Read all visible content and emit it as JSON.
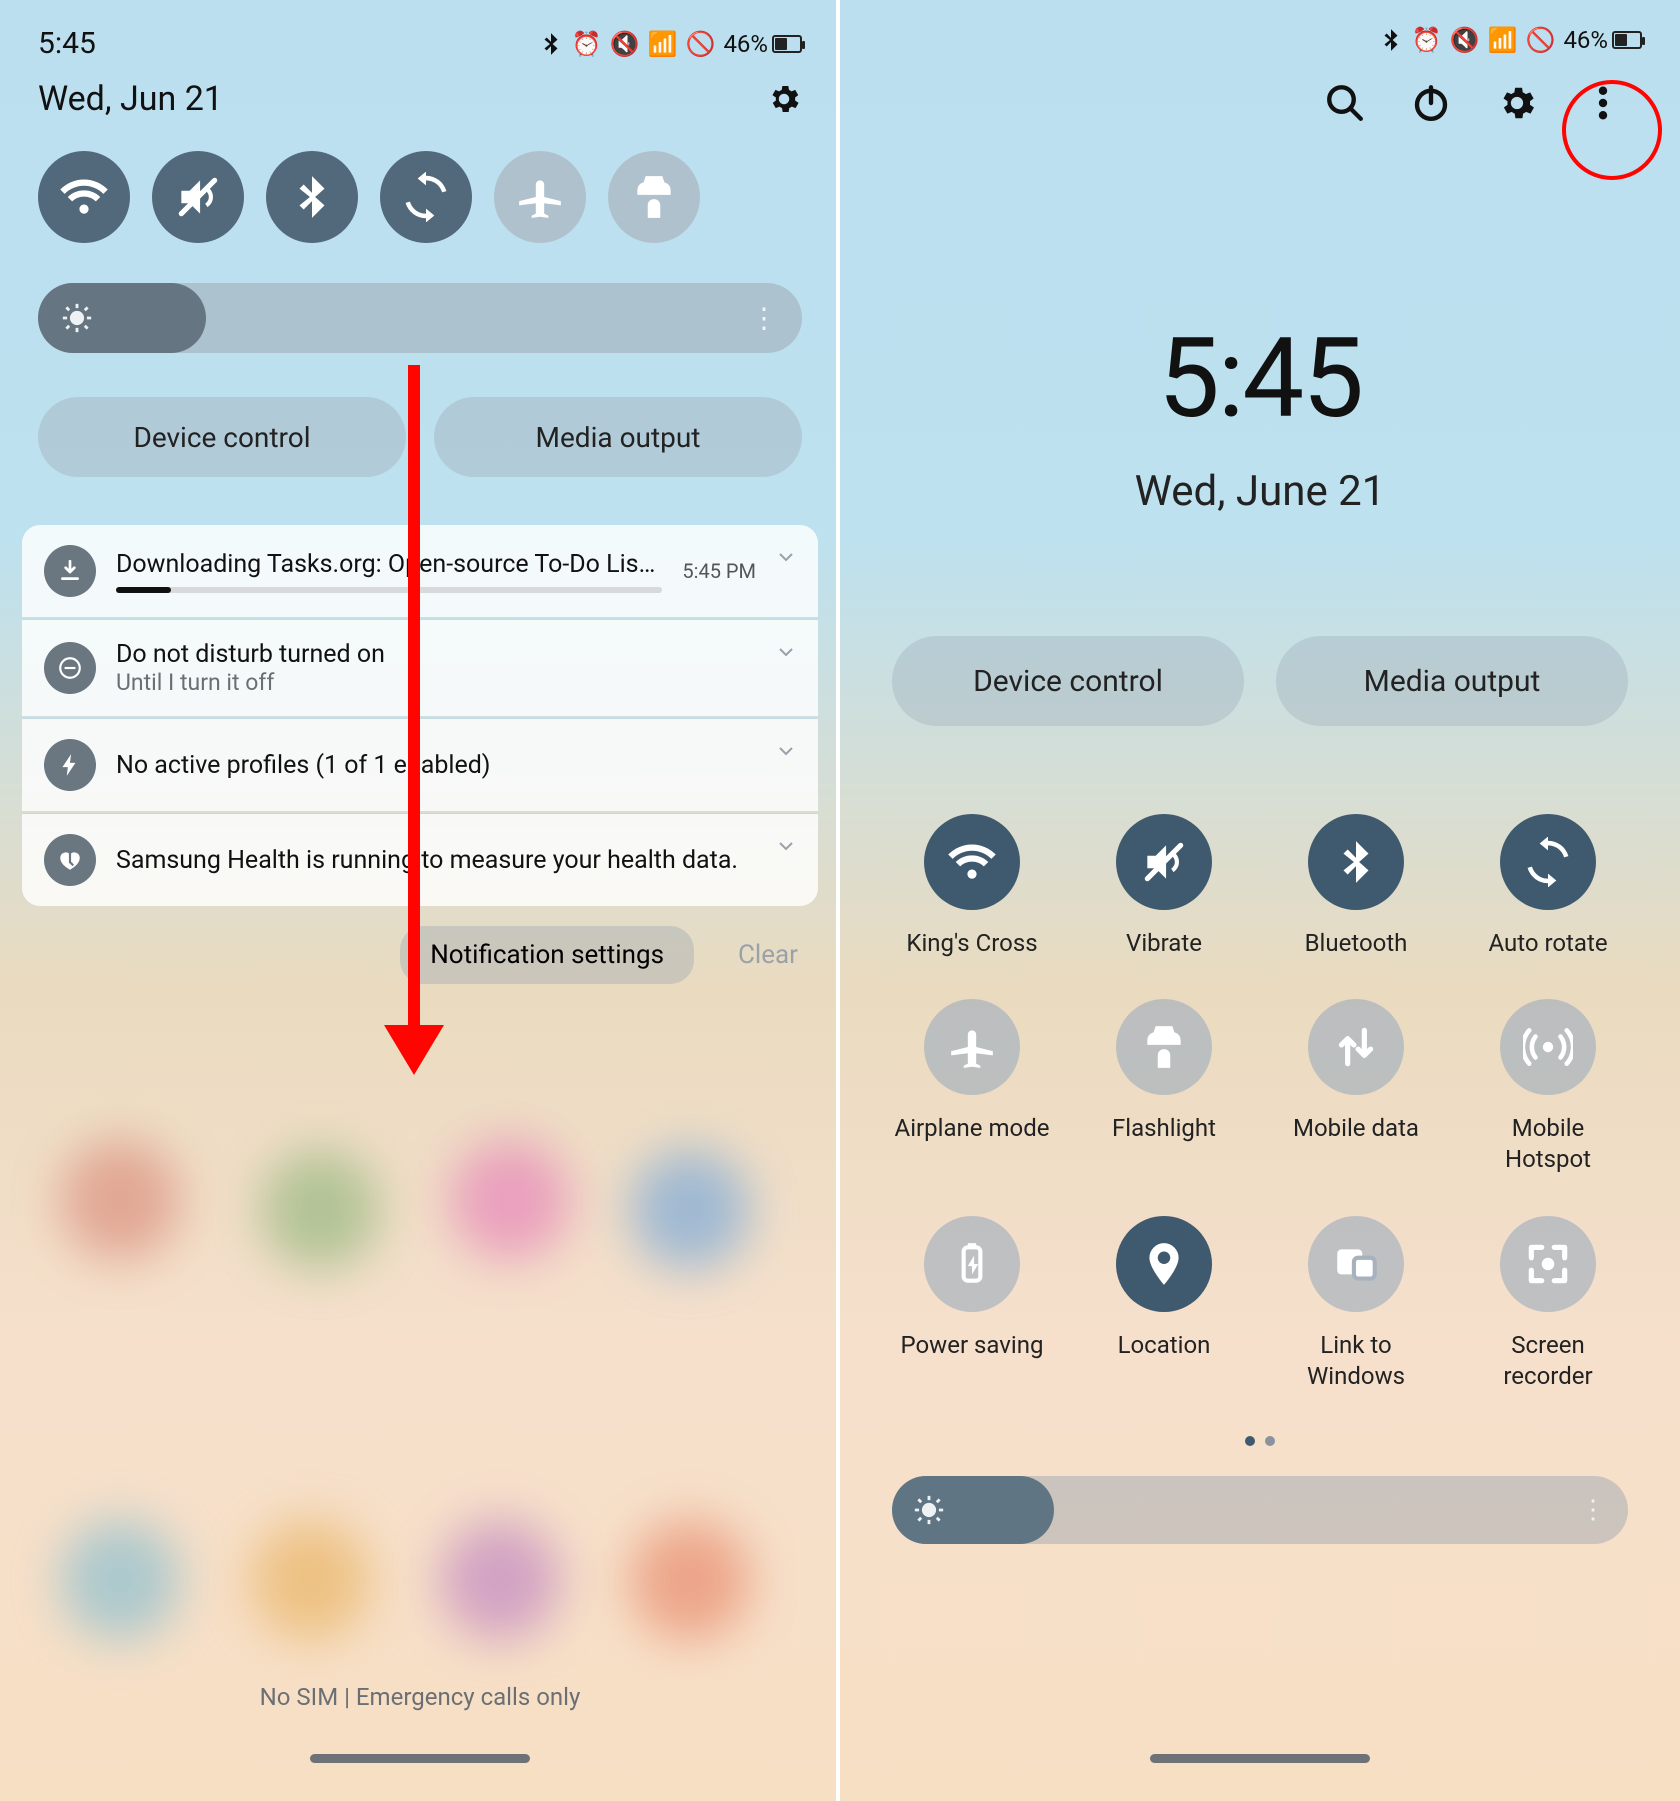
{
  "status": {
    "time": "5:45",
    "battery": "46%"
  },
  "left": {
    "date": "Wed, Jun 21",
    "device_control": "Device control",
    "media_output": "Media output",
    "brightness_percent": 22,
    "quick_toggles": [
      {
        "name": "wifi",
        "on": true
      },
      {
        "name": "vibrate",
        "on": true
      },
      {
        "name": "bluetooth",
        "on": true
      },
      {
        "name": "auto-rotate",
        "on": true
      },
      {
        "name": "airplane",
        "on": false
      },
      {
        "name": "flashlight",
        "on": false
      }
    ],
    "notifications": [
      {
        "icon": "download",
        "title": "Downloading Tasks.org: Open-source To-Do Lists &...",
        "time": "5:45 PM",
        "progress": 10
      },
      {
        "icon": "dnd",
        "title": "Do not disturb turned on",
        "sub": "Until I turn it off"
      },
      {
        "icon": "bolt",
        "title": "No active profiles (1 of 1 enabled)"
      },
      {
        "icon": "health",
        "title": "Samsung Health is running to measure your health data."
      }
    ],
    "notif_settings": "Notification settings",
    "clear": "Clear",
    "nosim": "No SIM | Emergency calls only"
  },
  "right": {
    "time": "5:45",
    "date": "Wed, June 21",
    "device_control": "Device control",
    "media_output": "Media output",
    "brightness_percent": 22,
    "tiles": [
      {
        "icon": "wifi",
        "label": "King's Cross",
        "on": true
      },
      {
        "icon": "vibrate",
        "label": "Vibrate",
        "on": true
      },
      {
        "icon": "bluetooth",
        "label": "Bluetooth",
        "on": true
      },
      {
        "icon": "auto-rotate",
        "label": "Auto rotate",
        "on": true
      },
      {
        "icon": "airplane",
        "label": "Airplane mode",
        "on": false
      },
      {
        "icon": "flashlight",
        "label": "Flashlight",
        "on": false
      },
      {
        "icon": "mobile-data",
        "label": "Mobile data",
        "on": false
      },
      {
        "icon": "hotspot",
        "label": "Mobile Hotspot",
        "on": false
      },
      {
        "icon": "power-saving",
        "label": "Power saving",
        "on": false
      },
      {
        "icon": "location",
        "label": "Location",
        "on": true
      },
      {
        "icon": "link-windows",
        "label": "Link to Windows",
        "on": false
      },
      {
        "icon": "screen-recorder",
        "label": "Screen recorder",
        "on": false
      }
    ]
  }
}
